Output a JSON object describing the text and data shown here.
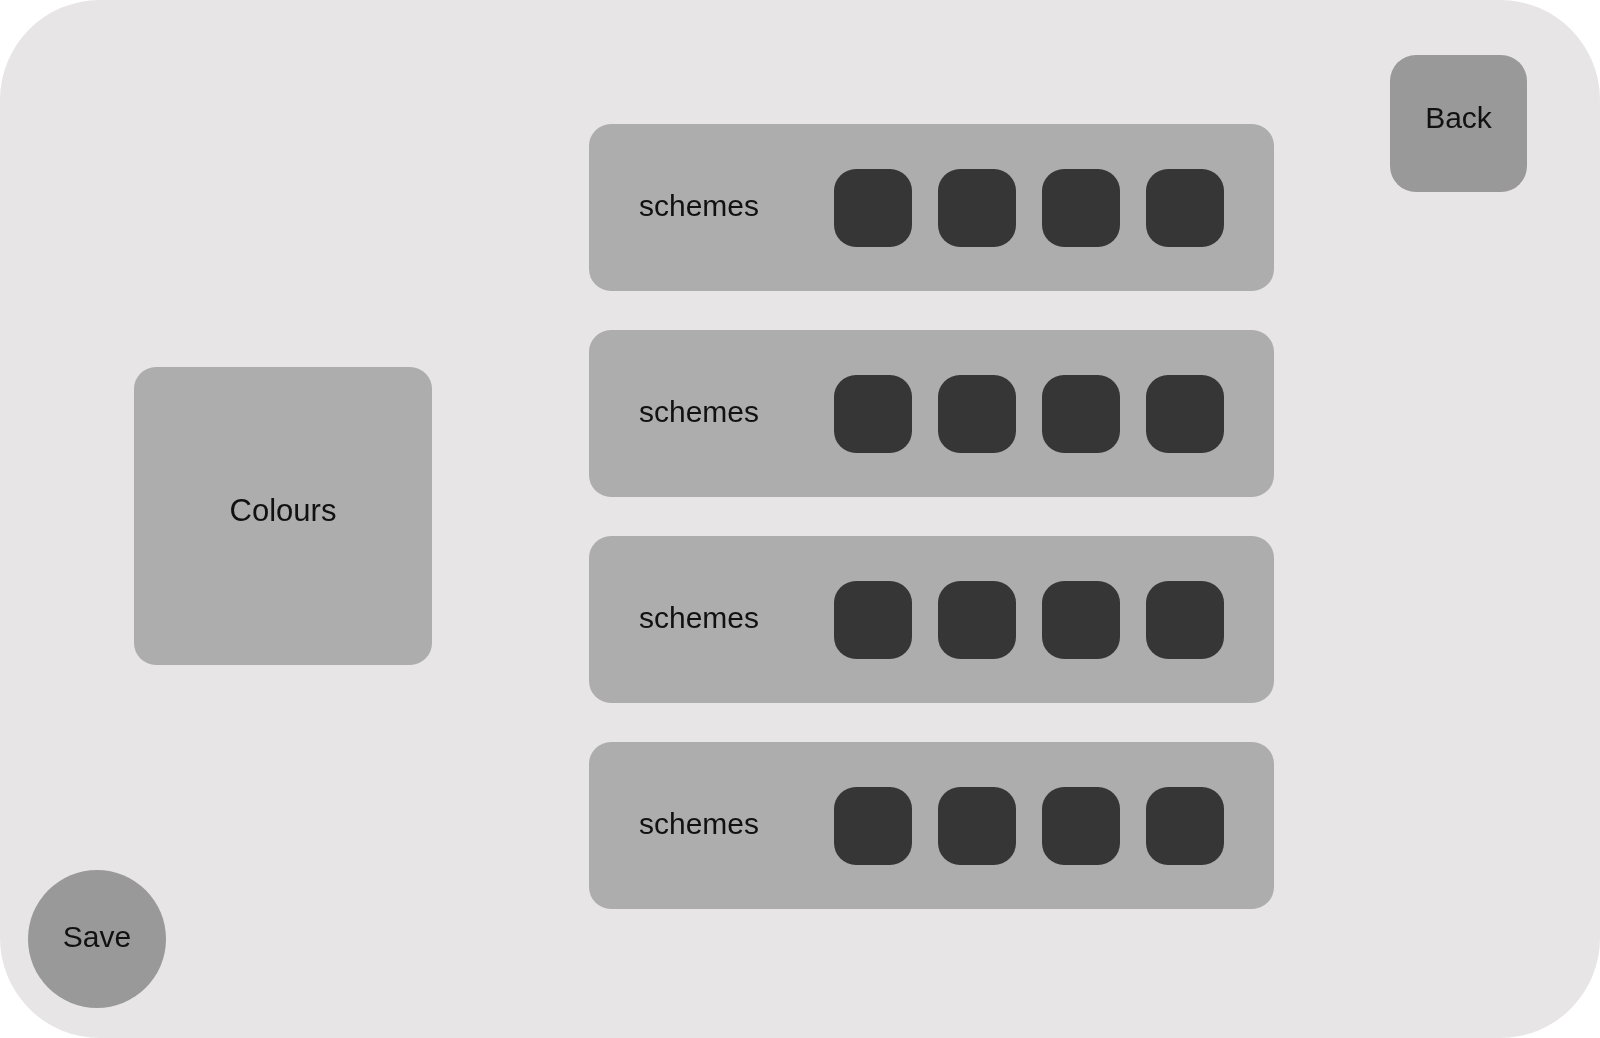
{
  "back_button": {
    "label": "Back"
  },
  "panel": {
    "title": "Colours"
  },
  "schemes": [
    {
      "label": "schemes",
      "swatches": [
        {
          "color": "#363636"
        },
        {
          "color": "#363636"
        },
        {
          "color": "#363636"
        },
        {
          "color": "#363636"
        }
      ]
    },
    {
      "label": "schemes",
      "swatches": [
        {
          "color": "#363636"
        },
        {
          "color": "#363636"
        },
        {
          "color": "#363636"
        },
        {
          "color": "#363636"
        }
      ]
    },
    {
      "label": "schemes",
      "swatches": [
        {
          "color": "#363636"
        },
        {
          "color": "#363636"
        },
        {
          "color": "#363636"
        },
        {
          "color": "#363636"
        }
      ]
    },
    {
      "label": "schemes",
      "swatches": [
        {
          "color": "#363636"
        },
        {
          "color": "#363636"
        },
        {
          "color": "#363636"
        },
        {
          "color": "#363636"
        }
      ]
    }
  ],
  "save_button": {
    "label": "Save"
  }
}
